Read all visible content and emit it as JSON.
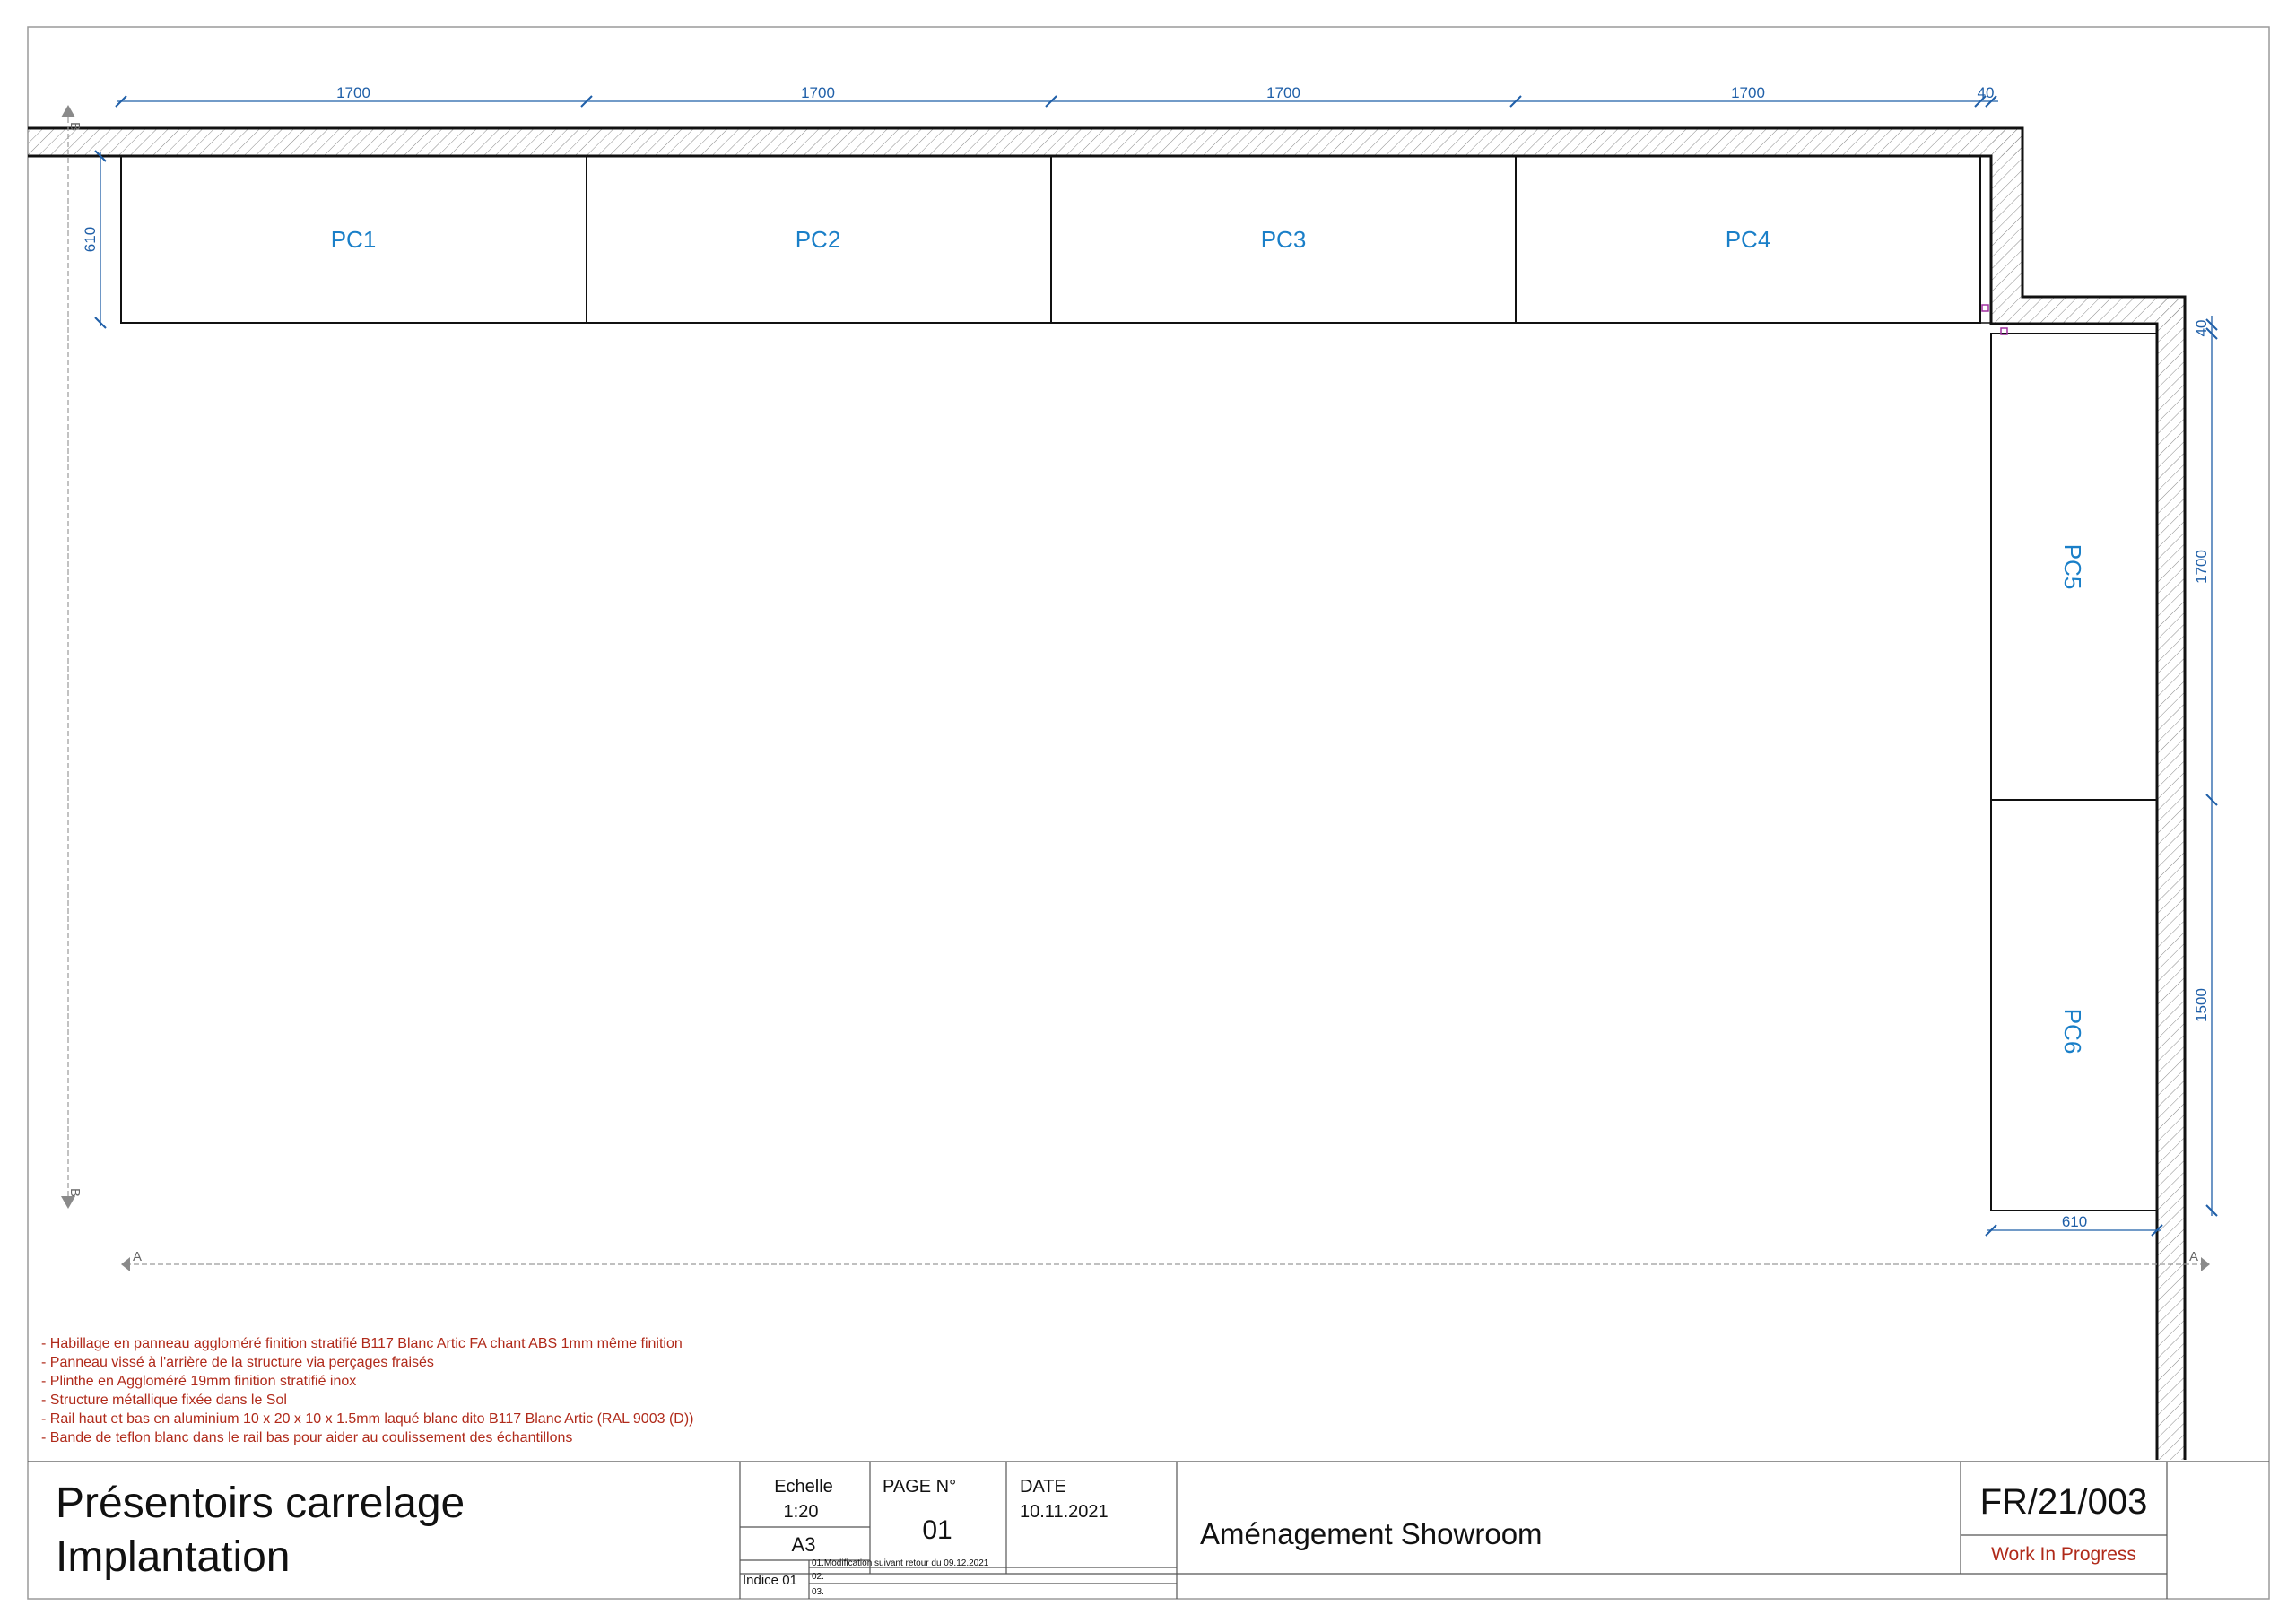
{
  "plan": {
    "top_dimensions": [
      "1700",
      "1700",
      "1700",
      "1700",
      "40"
    ],
    "left_depth": "610",
    "right_dimensions": [
      "40",
      "1700",
      "1500"
    ],
    "bottom_depth": "610",
    "cabinets": [
      "PC1",
      "PC2",
      "PC3",
      "PC4",
      "PC5",
      "PC6"
    ],
    "section_a": "A",
    "section_b": "B"
  },
  "notes": [
    "- Habillage en panneau aggloméré finition stratifié B117 Blanc Artic FA chant ABS 1mm même finition",
    "- Panneau vissé à l'arrière de la structure via perçages fraisés",
    "- Plinthe en Aggloméré 19mm finition stratifié inox",
    "- Structure métallique fixée dans le Sol",
    "- Rail haut et bas en aluminium 10 x 20 x 10 x 1.5mm laqué blanc dito B117 Blanc Artic (RAL 9003 (D))",
    "- Bande de teflon blanc dans le rail bas pour aider au coulissement des échantillons"
  ],
  "title_block": {
    "title_line1": "Présentoirs carrelage",
    "title_line2": "Implantation",
    "scale_label": "Echelle",
    "scale_value": "1:20",
    "format": "A3",
    "page_label": "PAGE N°",
    "page_value": "01",
    "date_label": "DATE",
    "date_value": "10.11.2021",
    "indice_label": "Indice 01",
    "revisions": [
      "01.Modification suivant retour du 09.12.2021",
      "02.",
      "03."
    ],
    "project": "Aménagement Showroom",
    "reference": "FR/21/003",
    "status": "Work In Progress"
  },
  "colors": {
    "dimension": "#1f5fa8",
    "cabinet_label": "#1a7fc8",
    "notes": "#b02a1a",
    "lines": "#111111"
  }
}
